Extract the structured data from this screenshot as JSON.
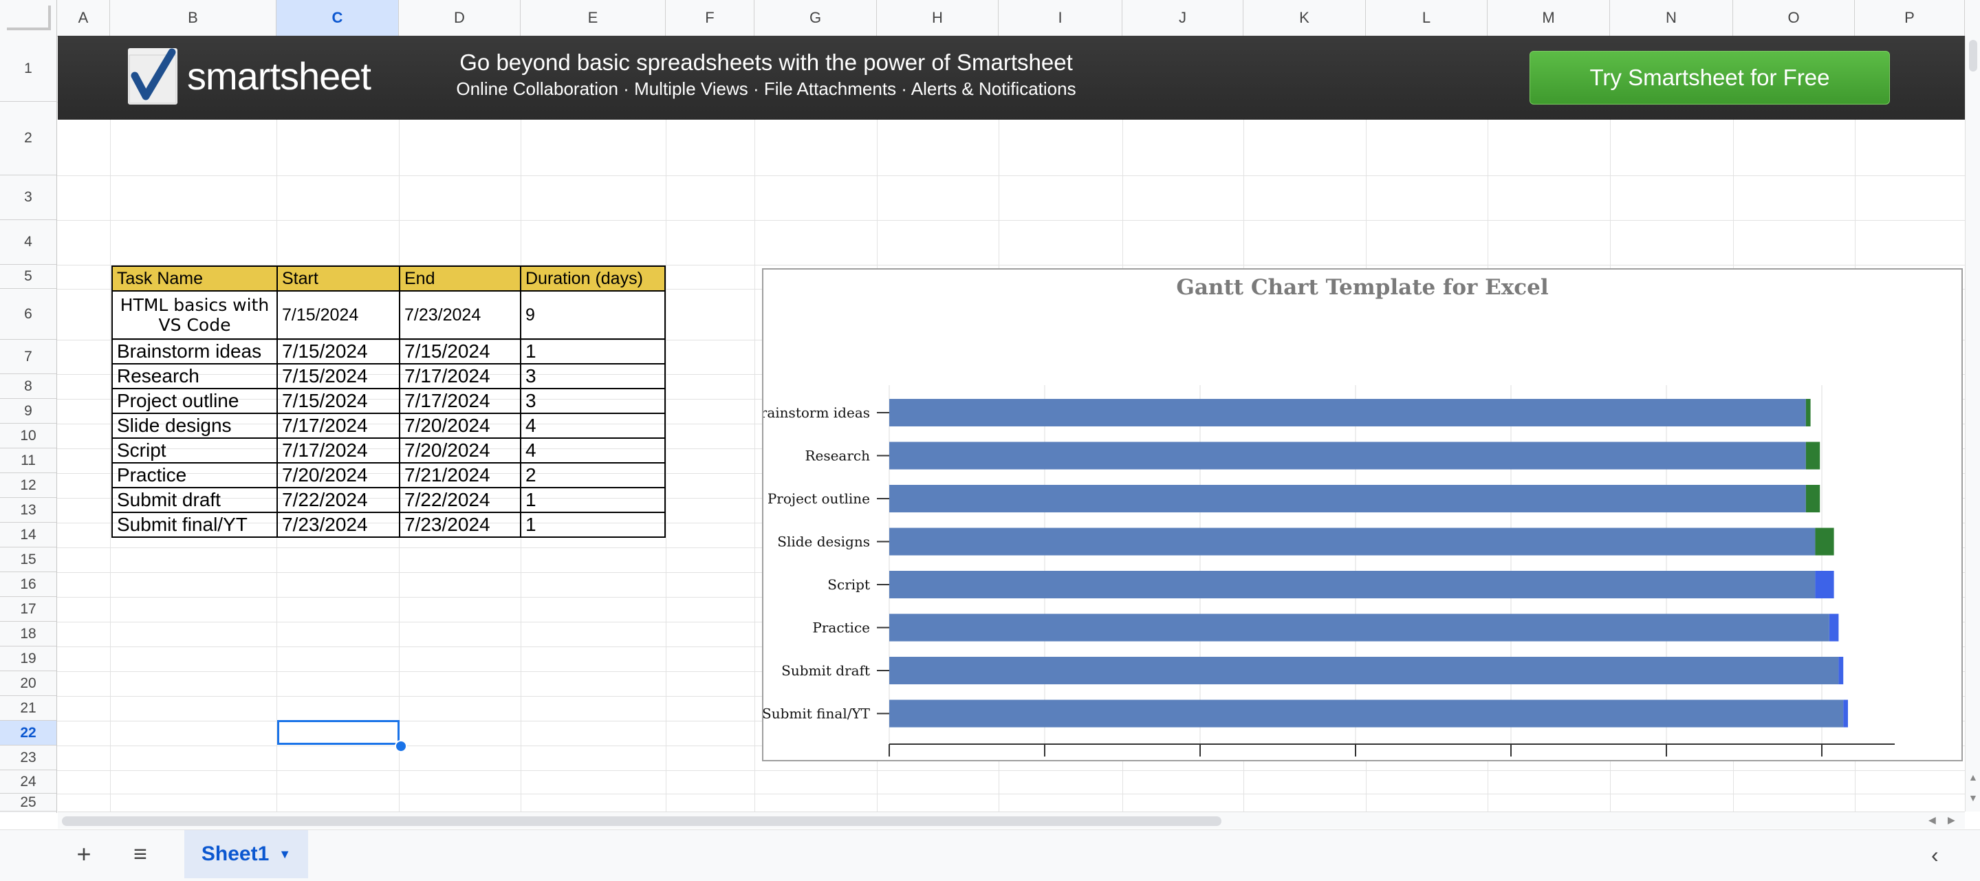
{
  "columns": [
    "A",
    "B",
    "C",
    "D",
    "E",
    "F",
    "G",
    "H",
    "I",
    "J",
    "K",
    "L",
    "M",
    "N",
    "O",
    "P"
  ],
  "selected_column": "C",
  "rows": [
    "1",
    "2",
    "3",
    "4",
    "5",
    "6",
    "7",
    "8",
    "9",
    "10",
    "11",
    "12",
    "13",
    "14",
    "15",
    "16",
    "17",
    "18",
    "19",
    "20",
    "21",
    "22",
    "23",
    "24",
    "25"
  ],
  "selected_row": "22",
  "banner": {
    "logo_text": "smartsheet",
    "title": "Go beyond basic spreadsheets with the power of Smartsheet",
    "subtitle": "Online Collaboration · Multiple Views · File Attachments · Alerts & Notifications",
    "button_label": "Try Smartsheet for Free",
    "background_color": "#323232",
    "button_color": "#4caf3a"
  },
  "task_table": {
    "headers": [
      "Task Name",
      "Start",
      "End",
      "Duration (days)"
    ],
    "header_color": "#e8c84a",
    "rows": [
      [
        "HTML basics with VS Code",
        "7/15/2024",
        "7/23/2024",
        "9"
      ],
      [
        "Brainstorm ideas",
        "7/15/2024",
        "7/15/2024",
        "1"
      ],
      [
        "Research",
        "7/15/2024",
        "7/17/2024",
        "3"
      ],
      [
        "Project outline",
        "7/15/2024",
        "7/17/2024",
        "3"
      ],
      [
        "Slide designs",
        "7/17/2024",
        "7/20/2024",
        "4"
      ],
      [
        "Script",
        "7/17/2024",
        "7/20/2024",
        "4"
      ],
      [
        "Practice",
        "7/20/2024",
        "7/21/2024",
        "2"
      ],
      [
        "Submit draft",
        "7/22/2024",
        "7/22/2024",
        "1"
      ],
      [
        "Submit final/YT",
        "7/23/2024",
        "7/23/2024",
        "1"
      ]
    ]
  },
  "chart_data": {
    "type": "bar",
    "orientation": "horizontal",
    "stacked": true,
    "title": "Gantt Chart Template for Excel",
    "categories": [
      "Brainstorm ideas",
      "Research",
      "Project outline",
      "Slide designs",
      "Script",
      "Practice",
      "Submit draft",
      "Submit final/YT"
    ],
    "start_dates": [
      "7/15/2024",
      "7/15/2024",
      "7/15/2024",
      "7/17/2024",
      "7/17/2024",
      "7/20/2024",
      "7/22/2024",
      "7/23/2024"
    ],
    "durations": [
      1,
      3,
      3,
      4,
      4,
      2,
      1,
      1
    ],
    "segment_colors": [
      "#2e7d32",
      "#2e7d32",
      "#2e7d32",
      "#2e7d32",
      "#3d63e8",
      "#3d63e8",
      "#3d63e8",
      "#3d63e8"
    ],
    "start_bar_color": "#5b80bc",
    "xlim": [
      "1/1/2024",
      "8/3/2024"
    ],
    "x_tick_labels_visible": false,
    "grid": "vertical",
    "legend": "none"
  },
  "sheet_tabs": {
    "add_label": "+",
    "all_sheets_label": "≡",
    "active": "Sheet1",
    "caret": "▼"
  }
}
